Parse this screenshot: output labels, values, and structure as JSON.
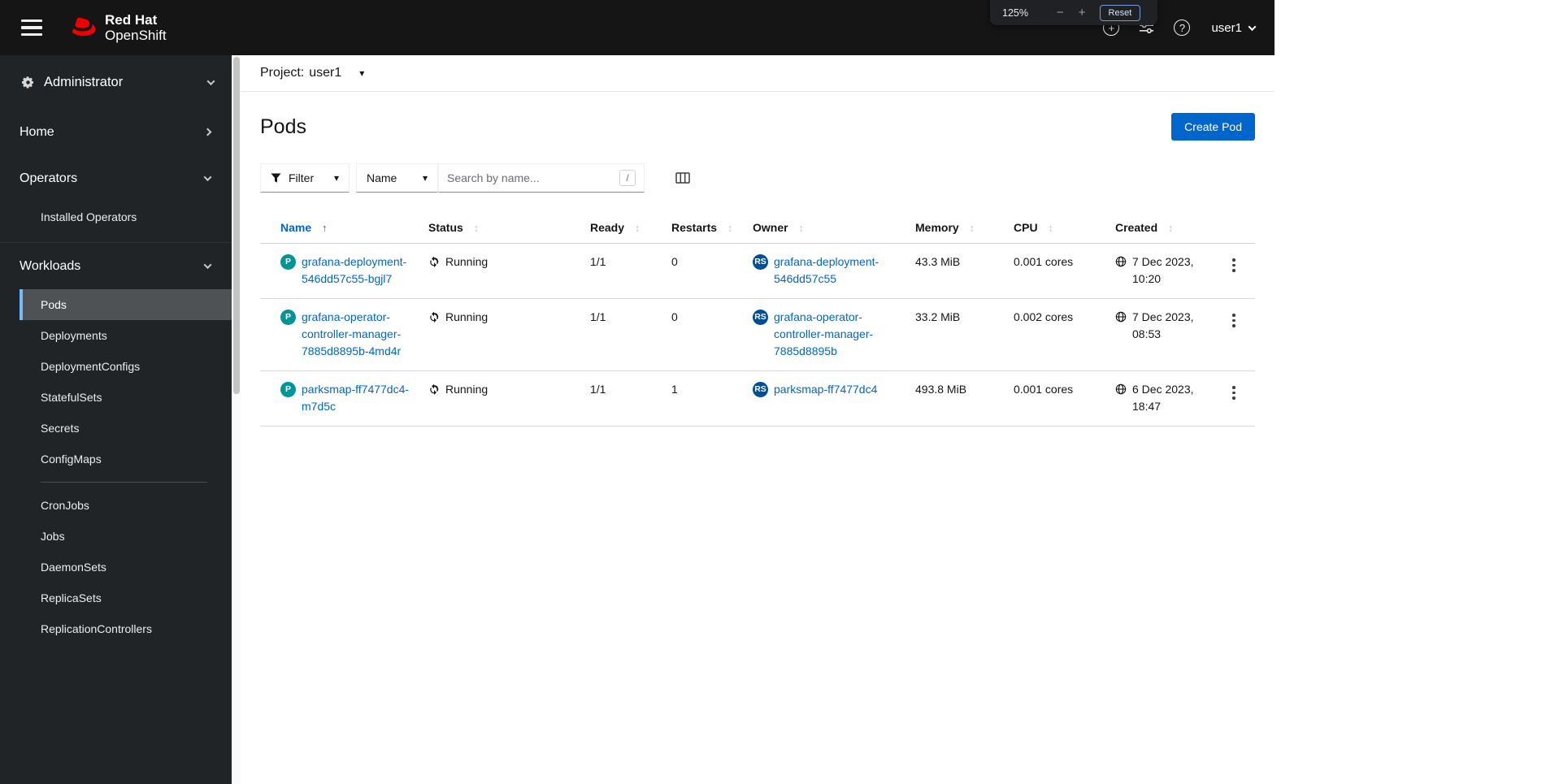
{
  "masthead": {
    "brand_line1": "Red Hat",
    "brand_line2": "OpenShift",
    "user": "user1"
  },
  "zoom_popup": {
    "level": "125%",
    "decrease": "−",
    "increase": "+",
    "reset": "Reset"
  },
  "icons": {
    "caret_down": "▾",
    "sort_ascending": "↑",
    "sortable": "↕",
    "plus": "+",
    "help": "?"
  },
  "sidebar": {
    "perspective": "Administrator",
    "sections": [
      {
        "label": "Home",
        "expanded": false
      },
      {
        "label": "Operators",
        "expanded": true,
        "items": [
          "Installed Operators"
        ]
      },
      {
        "label": "Workloads",
        "expanded": true,
        "active_item": "Pods",
        "items": [
          "Pods",
          "Deployments",
          "DeploymentConfigs",
          "StatefulSets",
          "Secrets",
          "ConfigMaps",
          "CronJobs",
          "Jobs",
          "DaemonSets",
          "ReplicaSets",
          "ReplicationControllers"
        ]
      }
    ]
  },
  "project_bar": {
    "label": "Project:",
    "name": "user1"
  },
  "page": {
    "title": "Pods",
    "create_button": "Create Pod"
  },
  "toolbar": {
    "filter_label": "Filter",
    "attribute": "Name",
    "search_placeholder": "Search by name...",
    "shortcut": "/"
  },
  "table": {
    "columns": [
      "Name",
      "Status",
      "Ready",
      "Restarts",
      "Owner",
      "Memory",
      "CPU",
      "Created"
    ],
    "sort": {
      "column": "Name",
      "direction": "ascending"
    },
    "badges": {
      "pod": {
        "text": "P",
        "color": "#009596"
      },
      "replicaset": {
        "text": "RS",
        "color": "#004d99"
      }
    },
    "rows": [
      {
        "name": "grafana-deployment-546dd57c55-bgjl7",
        "status": "Running",
        "ready": "1/1",
        "restarts": "0",
        "owner": "grafana-deployment-546dd57c55",
        "memory": "43.3 MiB",
        "cpu": "0.001 cores",
        "created": "7 Dec 2023, 10:20"
      },
      {
        "name": "grafana-operator-controller-manager-7885d8895b-4md4r",
        "status": "Running",
        "ready": "1/1",
        "restarts": "0",
        "owner": "grafana-operator-controller-manager-7885d8895b",
        "memory": "33.2 MiB",
        "cpu": "0.002 cores",
        "created": "7 Dec 2023, 08:53"
      },
      {
        "name": "parksmap-ff7477dc4-m7d5c",
        "status": "Running",
        "ready": "1/1",
        "restarts": "1",
        "owner": "parksmap-ff7477dc4",
        "memory": "493.8 MiB",
        "cpu": "0.001 cores",
        "created": "6 Dec 2023, 18:47"
      }
    ]
  },
  "colors": {
    "accent": "#0066cc",
    "masthead_bg": "#151515",
    "sidebar_bg": "#212427",
    "sidebar_active_bg": "#4f5255",
    "sidebar_active_border": "#73bcf7",
    "pod_badge": "#009596",
    "replicaset_badge": "#004d99",
    "link": "#0066cc"
  }
}
